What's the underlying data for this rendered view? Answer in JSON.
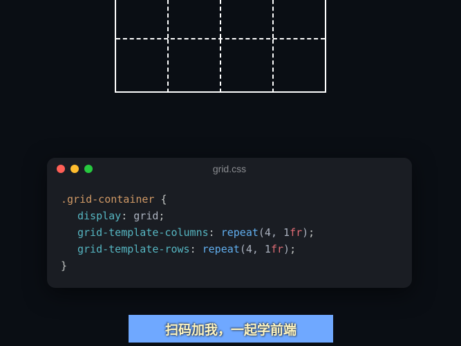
{
  "grid_demo": {
    "columns": 4,
    "visible_rows": 2
  },
  "window": {
    "filename": "grid.css"
  },
  "code": {
    "selector": ".grid-container",
    "open_brace": "{",
    "close_brace": "}",
    "lines": [
      {
        "prop": "display",
        "value_plain": "grid"
      },
      {
        "prop": "grid-template-columns",
        "func": "repeat",
        "args_prefix": "(4, 1",
        "unit": "fr",
        "args_suffix": ")"
      },
      {
        "prop": "grid-template-rows",
        "func": "repeat",
        "args_prefix": "(4, 1",
        "unit": "fr",
        "args_suffix": ")"
      }
    ]
  },
  "subtitle": {
    "text": "扫码加我，一起学前端"
  },
  "colors": {
    "window_bg": "#1a1d23",
    "page_bg": "#0a0e14",
    "subtitle_bg": "#6fa8ff",
    "subtitle_fg": "#fff5c0"
  }
}
